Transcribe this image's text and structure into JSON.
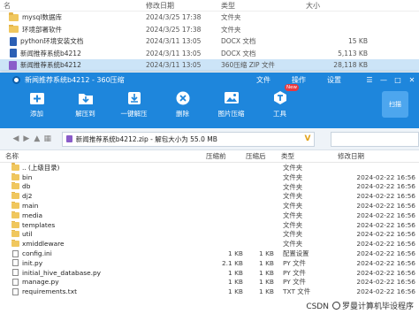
{
  "explorer": {
    "header": {
      "name": "名",
      "date": "修改日期",
      "type": "类型",
      "size": "大小"
    },
    "rows": [
      {
        "name": "mysql数据库",
        "date": "2024/3/25 17:38",
        "type": "文件夹",
        "size": "",
        "kind": "folder"
      },
      {
        "name": "环境部署软件",
        "date": "2024/3/25 17:38",
        "type": "文件夹",
        "size": "",
        "kind": "folder"
      },
      {
        "name": "python环境安装文档",
        "date": "2024/3/11 13:05",
        "type": "DOCX 文档",
        "size": "15 KB",
        "kind": "docx"
      },
      {
        "name": "新闻推荐系统b4212",
        "date": "2024/3/11 13:05",
        "type": "DOCX 文档",
        "size": "5,113 KB",
        "kind": "docx"
      },
      {
        "name": "新闻推荐系统b4212",
        "date": "2024/3/11 13:05",
        "type": "360压缩 ZIP 文件",
        "size": "28,118 KB",
        "kind": "zip",
        "selected": true
      }
    ]
  },
  "zip_window": {
    "title": "新闻推荐系统b4212 - 360压缩",
    "menu": [
      "文件",
      "操作",
      "设置"
    ],
    "window_controls": [
      "☰",
      "—",
      "□",
      "✕"
    ],
    "toolbar": [
      {
        "label": "添加",
        "icon": "add-icon"
      },
      {
        "label": "解压到",
        "icon": "extract-to-icon"
      },
      {
        "label": "一键解压",
        "icon": "one-click-extract-icon"
      },
      {
        "label": "删除",
        "icon": "delete-icon"
      },
      {
        "label": "图片压缩",
        "icon": "image-compress-icon"
      },
      {
        "label": "工具",
        "icon": "tools-icon",
        "badge": "New"
      }
    ],
    "scan_label": "扫描",
    "address": "新闻推荐系统b4212.zip - 解包大小为 55.0 MB",
    "columns": {
      "name": "名称",
      "compressed": "压缩前",
      "original": "压缩后",
      "type": "类型",
      "modified": "修改日期"
    },
    "files": [
      {
        "name": ".. (上级目录)",
        "compressed": "",
        "original": "",
        "type": "文件夹",
        "modified": "",
        "kind": "folder"
      },
      {
        "name": "bin",
        "compressed": "",
        "original": "",
        "type": "文件夹",
        "modified": "2024-02-22 16:56",
        "kind": "folder"
      },
      {
        "name": "db",
        "compressed": "",
        "original": "",
        "type": "文件夹",
        "modified": "2024-02-22 16:56",
        "kind": "folder"
      },
      {
        "name": "dj2",
        "compressed": "",
        "original": "",
        "type": "文件夹",
        "modified": "2024-02-22 16:56",
        "kind": "folder"
      },
      {
        "name": "main",
        "compressed": "",
        "original": "",
        "type": "文件夹",
        "modified": "2024-02-22 16:56",
        "kind": "folder"
      },
      {
        "name": "media",
        "compressed": "",
        "original": "",
        "type": "文件夹",
        "modified": "2024-02-22 16:56",
        "kind": "folder"
      },
      {
        "name": "templates",
        "compressed": "",
        "original": "",
        "type": "文件夹",
        "modified": "2024-02-22 16:56",
        "kind": "folder"
      },
      {
        "name": "util",
        "compressed": "",
        "original": "",
        "type": "文件夹",
        "modified": "2024-02-22 16:56",
        "kind": "folder"
      },
      {
        "name": "xmiddleware",
        "compressed": "",
        "original": "",
        "type": "文件夹",
        "modified": "2024-02-22 16:56",
        "kind": "folder"
      },
      {
        "name": "config.ini",
        "compressed": "1 KB",
        "original": "1 KB",
        "type": "配置设置",
        "modified": "2024-02-22 16:56",
        "kind": "file"
      },
      {
        "name": "init.py",
        "compressed": "2.1 KB",
        "original": "1 KB",
        "type": "PY 文件",
        "modified": "2024-02-22 16:56",
        "kind": "file"
      },
      {
        "name": "initial_hive_database.py",
        "compressed": "1 KB",
        "original": "1 KB",
        "type": "PY 文件",
        "modified": "2024-02-22 16:56",
        "kind": "file"
      },
      {
        "name": "manage.py",
        "compressed": "1 KB",
        "original": "1 KB",
        "type": "PY 文件",
        "modified": "2024-02-22 16:56",
        "kind": "file"
      },
      {
        "name": "requirements.txt",
        "compressed": "1 KB",
        "original": "1 KB",
        "type": "TXT 文件",
        "modified": "2024-02-22 16:56",
        "kind": "file"
      }
    ]
  },
  "watermark": {
    "prefix": "CSDN",
    "text": "罗曼计算机毕设程序"
  }
}
